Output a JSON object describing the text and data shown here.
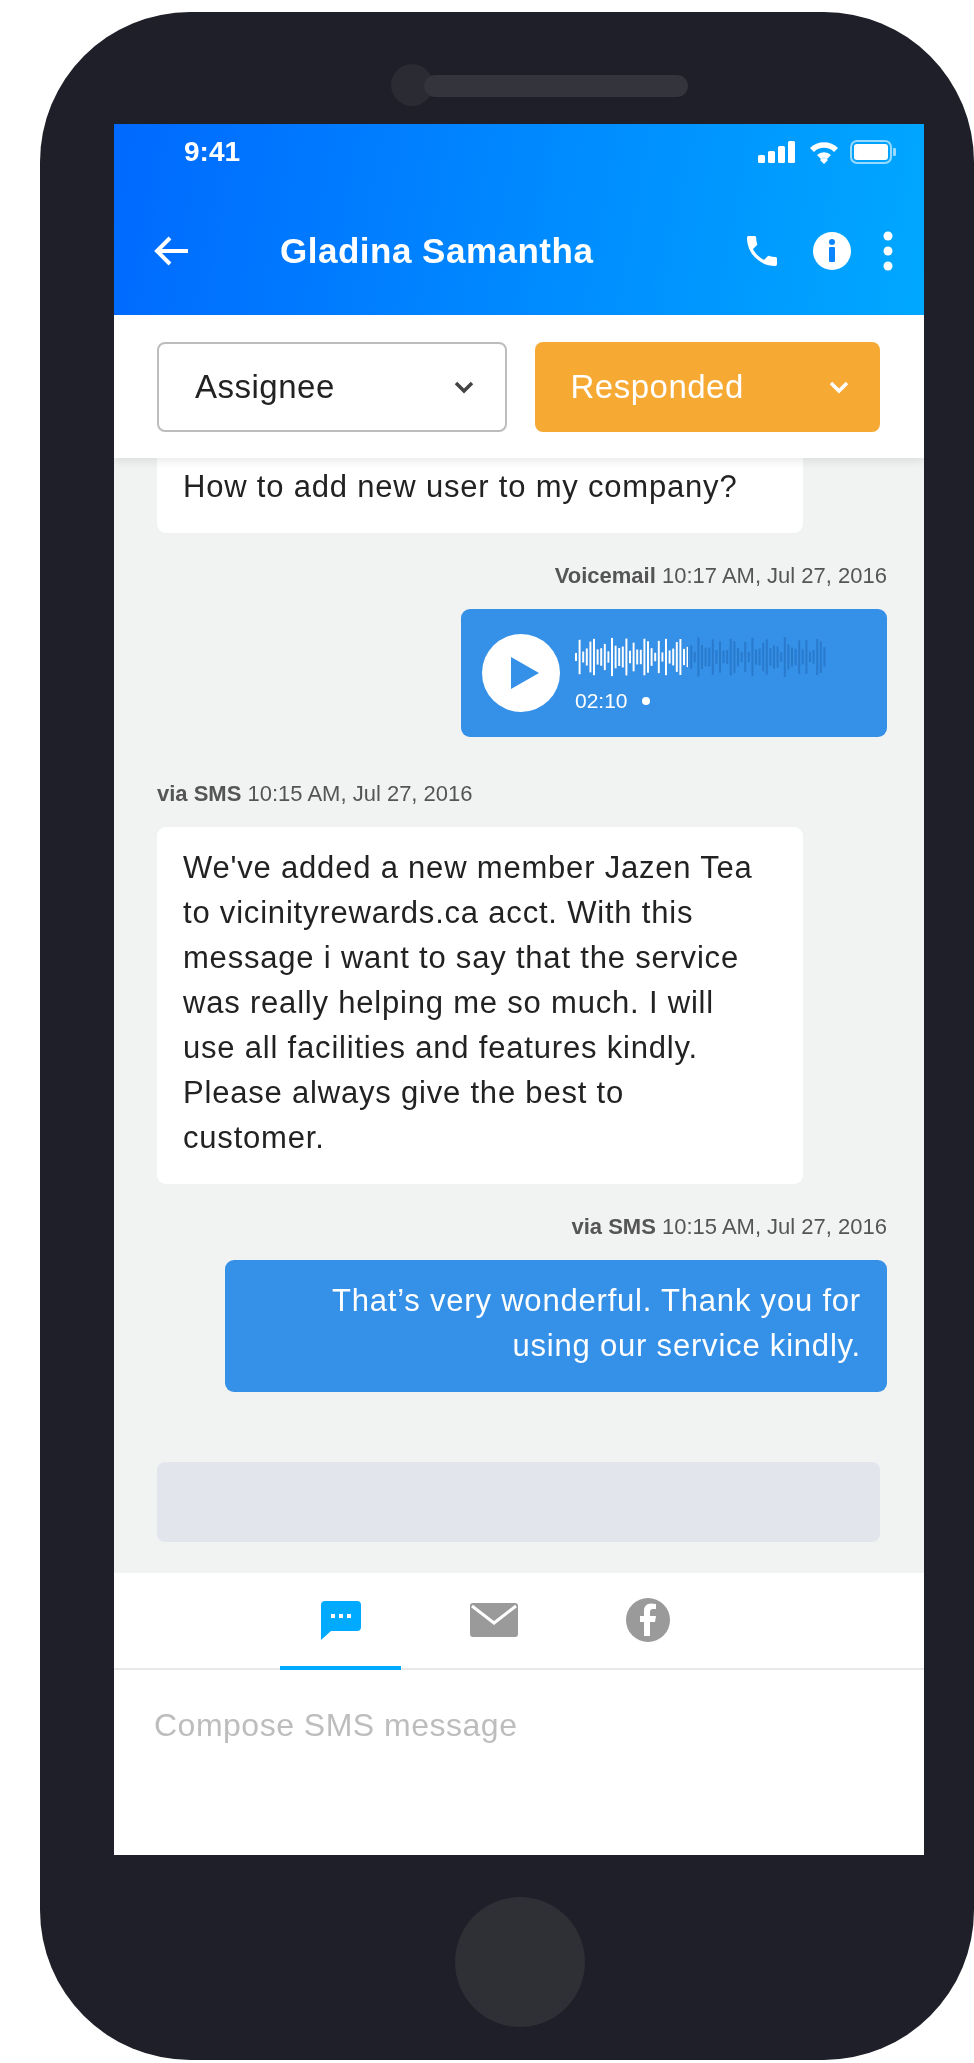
{
  "status_bar": {
    "time": "9:41"
  },
  "header": {
    "title": "Gladina Samantha"
  },
  "filters": [
    {
      "kind": "outline",
      "label": "Assignee"
    },
    {
      "kind": "status",
      "label": "Responded"
    }
  ],
  "messages": [
    {
      "kind": "text",
      "sent": false,
      "text": "How to add new user to my company?"
    },
    {
      "kind": "voicemail",
      "sent": true,
      "channel": "Voicemail",
      "time": "10:17 AM, Jul 27, 2016",
      "duration": "02:10",
      "level": 0.45
    },
    {
      "kind": "text",
      "sent": false,
      "channel": "via SMS",
      "time": "10:15 AM, Jul 27, 2016",
      "text": "We've added a new member Jazen Tea to vicinityrewards.ca acct. With this message i want to say that the service was really helping me so much. I will use all facilities and features kindly. Please always give the best to customer."
    },
    {
      "kind": "text",
      "sent": true,
      "channel": "via SMS",
      "time": "10:15 AM, Jul 27, 2016",
      "text": "That’s very wonderful. Thank you for using our service kindly."
    },
    {
      "kind": "notice"
    }
  ],
  "compose_tabs": [
    {
      "kind": "sms",
      "selected": true
    },
    {
      "kind": "email",
      "selected": false
    },
    {
      "kind": "facebook",
      "selected": false
    }
  ],
  "compose": {
    "placeholder": "Compose SMS message"
  }
}
